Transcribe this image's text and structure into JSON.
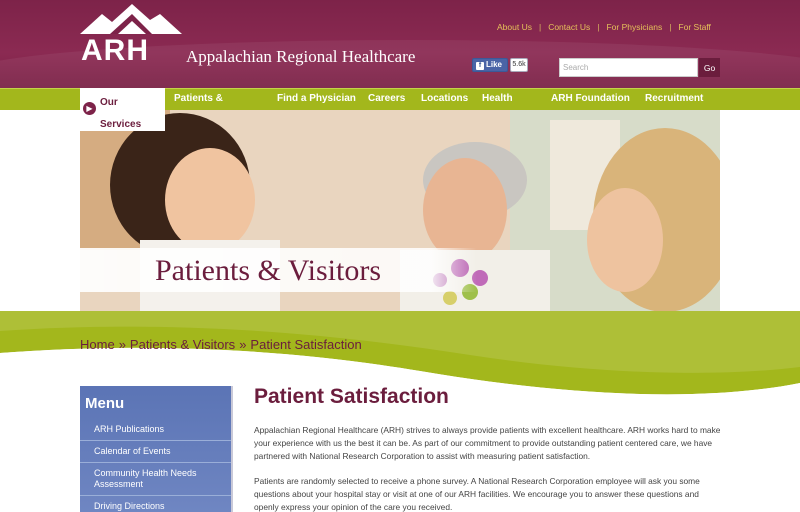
{
  "header": {
    "logo_text": "ARH",
    "org_name": "Appalachian Regional Healthcare",
    "util_links": [
      "About Us",
      "Contact Us",
      "For Physicians",
      "For Staff"
    ],
    "facebook": {
      "label": "Like",
      "count": "5.6k"
    },
    "search": {
      "placeholder": "Search",
      "button": "Go"
    }
  },
  "nav": {
    "items": [
      "Our Services",
      "Patients & Visitors",
      "Find a Physician",
      "Careers",
      "Locations",
      "Health Info",
      "ARH Foundation",
      "Recruitment"
    ]
  },
  "banner": {
    "title": "Patients & Visitors"
  },
  "breadcrumb": [
    "Home",
    "Patients & Visitors",
    "Patient Satisfaction"
  ],
  "breadcrumb_sep": "»",
  "sidebar": {
    "title": "Menu",
    "items": [
      "ARH Publications",
      "Calendar of Events",
      "Community Health Needs Assessment",
      "Driving Directions"
    ]
  },
  "content": {
    "title": "Patient Satisfaction",
    "paragraphs": [
      "Appalachian Regional Healthcare (ARH) strives to always provide patients with excellent healthcare. ARH works hard to make your experience with us the best it can be. As part of our commitment to provide outstanding patient centered care, we have partnered with National Research Corporation to assist with measuring patient satisfaction.",
      "Patients are randomly selected to receive a phone survey. A National Research Corporation employee will ask you some questions about your hospital stay or visit at one of our ARH facilities. We encourage you to answer these questions and openly express your opinion of the care you received."
    ]
  },
  "colors": {
    "brand_maroon": "#7d2349",
    "nav_green": "#a3b71c",
    "accent_gold": "#e5c15a",
    "menu_blue": "#5b74b5"
  }
}
